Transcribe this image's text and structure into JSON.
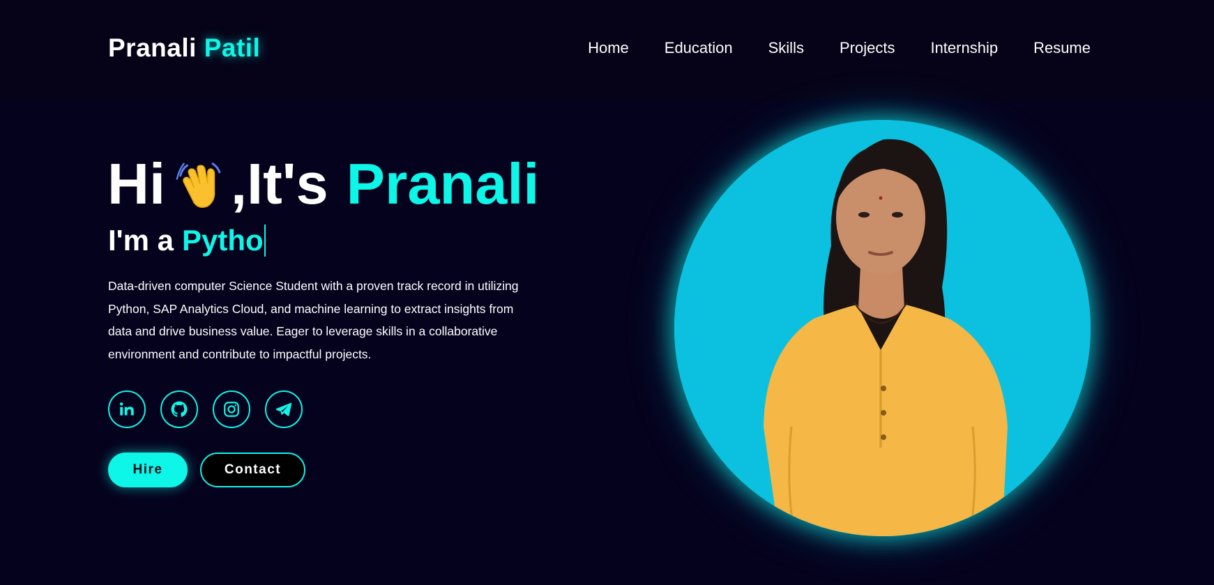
{
  "header": {
    "logo_first": "Pranali",
    "logo_second": "Patil",
    "nav": [
      {
        "label": "Home"
      },
      {
        "label": "Education"
      },
      {
        "label": "Skills"
      },
      {
        "label": "Projects"
      },
      {
        "label": "Internship"
      },
      {
        "label": "Resume"
      }
    ]
  },
  "hero": {
    "greeting_hi": "Hi",
    "greeting_its": ",It's",
    "greeting_name": "Pranali",
    "wave_icon": "waving-hand-icon",
    "subtitle_prefix": "I'm a",
    "subtitle_typed": "Pytho",
    "description": "Data-driven computer Science Student with a proven track record in utilizing Python, SAP Analytics Cloud, and machine learning to extract insights from data and drive business value. Eager to leverage skills in a collaborative environment and contribute to impactful projects.",
    "socials": [
      {
        "icon": "linkedin-icon"
      },
      {
        "icon": "github-icon"
      },
      {
        "icon": "instagram-icon"
      },
      {
        "icon": "telegram-icon"
      }
    ],
    "hire_label": "Hire",
    "contact_label": "Contact"
  },
  "colors": {
    "background": "#05021d",
    "accent": "#0ef6e8",
    "photo_bg": "#0cc0e0"
  }
}
